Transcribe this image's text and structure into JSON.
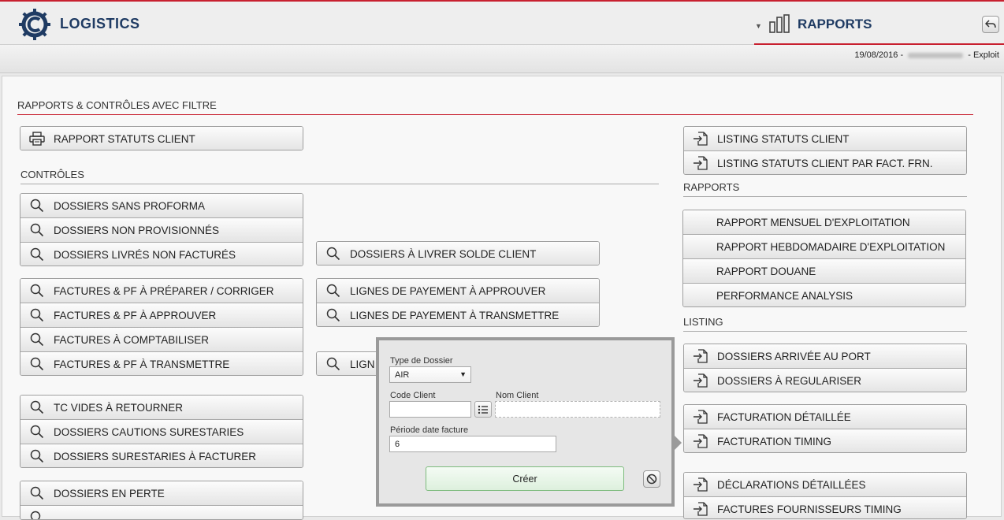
{
  "app": {
    "title": "LOGISTICS"
  },
  "section_header": {
    "title": "RAPPORTS"
  },
  "user_bar": {
    "date": "19/08/2016",
    "sep1": " - ",
    "sep2": " - ",
    "role": "Exploit"
  },
  "main": {
    "title": "RAPPORTS & CONTRÔLES AVEC FILTRE"
  },
  "groups": {
    "rapport_statuts": [
      "RAPPORT STATUTS CLIENT"
    ],
    "controles_heading": "CONTRÔLES",
    "dossiers_1": [
      "DOSSIERS SANS PROFORMA",
      "DOSSIERS NON PROVISIONNÉS",
      "DOSSIERS LIVRÉS NON FACTURÉS"
    ],
    "dossiers_livrer": [
      "DOSSIERS À LIVRER SOLDE CLIENT"
    ],
    "factures": [
      "FACTURES & PF À PRÉPARER / CORRIGER",
      "FACTURES  & PF À APPROUVER",
      "FACTURES À COMPTABILISER",
      "FACTURES  & PF À TRANSMETTRE"
    ],
    "lignes": [
      "LIGNES DE PAYEMENT À APPROUVER",
      "LIGNES DE PAYEMENT À TRANSMETTRE"
    ],
    "lignes_partial": [
      "LIGN"
    ],
    "tc": [
      "TC VIDES À RETOURNER",
      "DOSSIERS CAUTIONS SURESTARIES",
      "DOSSIERS SURESTARIES À FACTURER"
    ],
    "perte": [
      "DOSSIERS EN PERTE",
      ""
    ],
    "listing_statuts": [
      "LISTING STATUTS CLIENT",
      "LISTING STATUTS CLIENT PAR FACT. FRN."
    ],
    "rapports_heading": "RAPPORTS",
    "rapports": [
      "RAPPORT MENSUEL D'EXPLOITATION",
      "RAPPORT HEBDOMADAIRE D'EXPLOITATION",
      "RAPPORT DOUANE",
      "PERFORMANCE ANALYSIS"
    ],
    "listing_heading": "LISTING",
    "listing_dossiers": [
      "DOSSIERS ARRIVÉE AU PORT",
      "DOSSIERS À REGULARISER"
    ],
    "facturation": [
      "FACTURATION DÉTAILLÉE",
      "FACTURATION TIMING"
    ],
    "declarations": [
      "DÉCLARATIONS DÉTAILLÉES",
      "FACTURES FOURNISSEURS TIMING"
    ]
  },
  "popup": {
    "type_label": "Type de Dossier",
    "type_value": "AIR",
    "code_label": "Code Client",
    "code_value": "",
    "nom_label": "Nom Client",
    "nom_value": "",
    "periode_label": "Période date facture",
    "periode_value": "6",
    "create_label": "Créer"
  },
  "colors": {
    "accent": "#c8202f",
    "brand": "#1f3b63"
  }
}
